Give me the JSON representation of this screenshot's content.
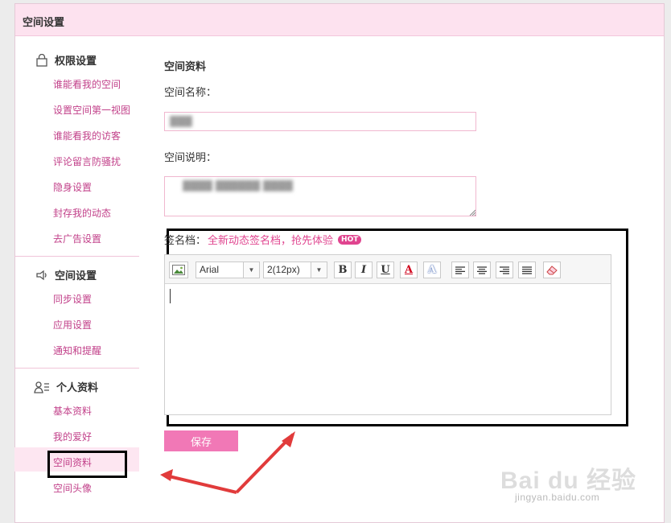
{
  "header": {
    "title": "空间设置"
  },
  "sidebar": {
    "sections": [
      {
        "title": "权限设置",
        "icon": "lock-icon",
        "items": [
          "谁能看我的空间",
          "设置空间第一视图",
          "谁能看我的访客",
          "评论留言防骚扰",
          "隐身设置",
          "封存我的动态",
          "去广告设置"
        ]
      },
      {
        "title": "空间设置",
        "icon": "speaker-icon",
        "items": [
          "同步设置",
          "应用设置",
          "通知和提醒"
        ]
      },
      {
        "title": "个人资料",
        "icon": "user-list-icon",
        "items": [
          "基本资料",
          "我的爱好",
          "空间资料",
          "空间头像"
        ]
      }
    ],
    "active_item": "空间资料"
  },
  "form": {
    "heading": "空间资料",
    "name_label": "空间名称：",
    "name_value": "▓▓▓",
    "desc_label": "空间说明：",
    "desc_value": "▓▓▓▓ ▓▓▓▓▓▓ ▓▓▓▓",
    "signature_label": "签名档：",
    "signature_link": "全新动态签名档，抢先体验",
    "hot_badge": "HOT",
    "editor": {
      "font_family": "Arial",
      "font_size": "2(12px)",
      "bold": "B",
      "italic": "I",
      "underline": "U",
      "font_color": "A",
      "highlight": "A",
      "text_color_accent": "#d0021b"
    },
    "save_label": "保存"
  },
  "watermark": {
    "brand": "Bai du 经验",
    "url": "jingyan.baidu.com"
  },
  "colors": {
    "accent": "#e0448f",
    "header_bg": "#fde2ef",
    "button": "#f178b6"
  }
}
